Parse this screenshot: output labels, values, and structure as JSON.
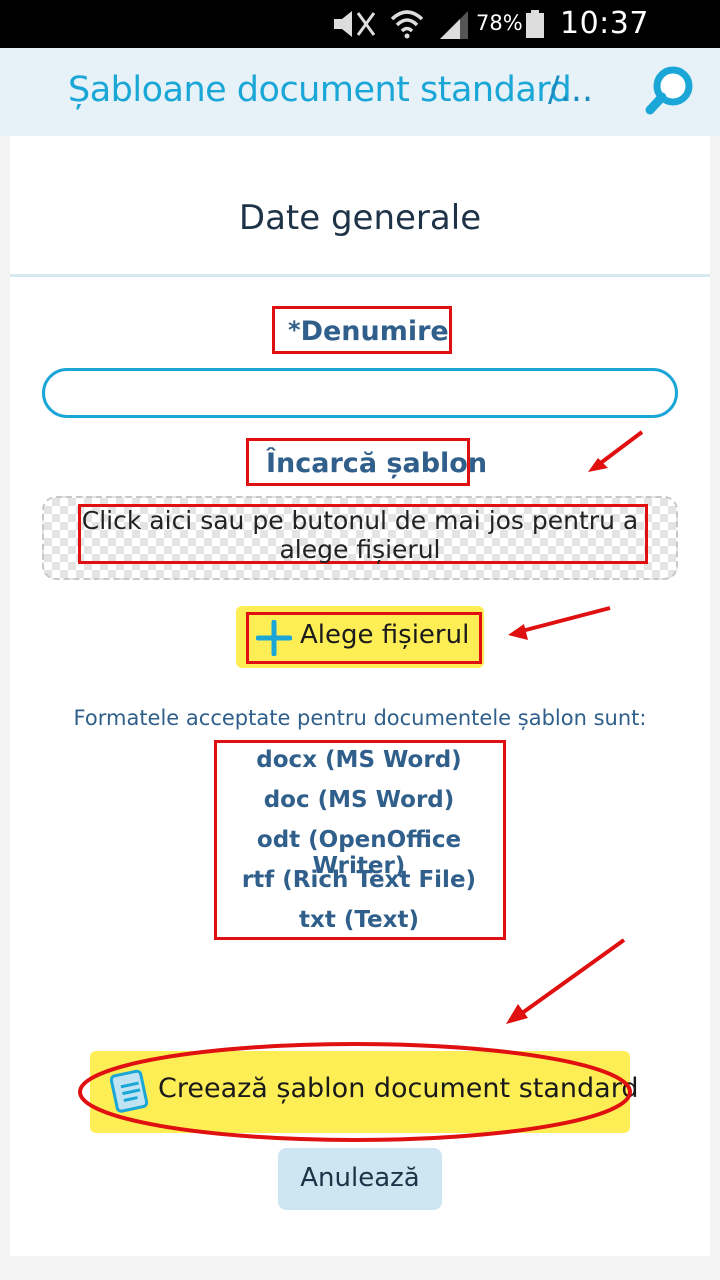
{
  "status_bar": {
    "battery_percent": "78%",
    "time": "10:37 a.m.",
    "icons": [
      "mute-icon",
      "wifi-icon",
      "signal-icon",
      "battery-icon"
    ]
  },
  "header": {
    "title": "Șabloane document standard",
    "crumb": "/...",
    "search_icon": "search-icon"
  },
  "form": {
    "section_title": "Date generale",
    "name_label_required": "*",
    "name_label": "Denumire",
    "name_value": "",
    "upload_label": "Încarcă șablon",
    "dropzone_text": "Click aici sau pe butonul de mai jos pentru a alege fișierul",
    "choose_button_label": "Alege fișierul",
    "formats_intro": "Formatele acceptate pentru documentele șablon sunt:",
    "formats": [
      "docx (MS Word)",
      "doc (MS Word)",
      "odt (OpenOffice Writer)",
      "rtf (Rich Text File)",
      "txt (Text)"
    ],
    "create_button_label": "Creează șablon document standard",
    "cancel_button_label": "Anulează"
  },
  "colors": {
    "accent": "#1aa6d6",
    "label_text": "#2f5f8a",
    "button_yellow": "#fdee56",
    "cancel_bg": "#cde6f2",
    "annotation_red": "#e01010"
  }
}
